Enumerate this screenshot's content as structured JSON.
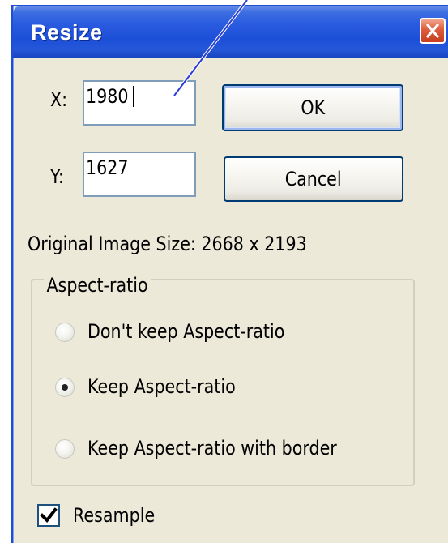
{
  "window": {
    "title": "Resize"
  },
  "fields": {
    "x_label": "X:",
    "x_value": "1980",
    "y_label": "Y:",
    "y_value": "1627"
  },
  "buttons": {
    "ok": "OK",
    "cancel": "Cancel"
  },
  "original_size": "Original Image Size: 2668 x 2193",
  "aspect_group": {
    "title": "Aspect-ratio",
    "options": [
      {
        "label": "Don't keep Aspect-ratio",
        "selected": false
      },
      {
        "label": "Keep Aspect-ratio",
        "selected": true
      },
      {
        "label": "Keep Aspect-ratio with border",
        "selected": false
      }
    ]
  },
  "resample": {
    "label": "Resample",
    "checked": true
  },
  "colors": {
    "titlebar": "#2a5be0",
    "dialog_bg": "#ece9d8",
    "close_button": "#e06040",
    "annotation_line": "#2a3cd8"
  },
  "icons": {
    "close": "close-icon",
    "check": "checkmark-icon"
  }
}
